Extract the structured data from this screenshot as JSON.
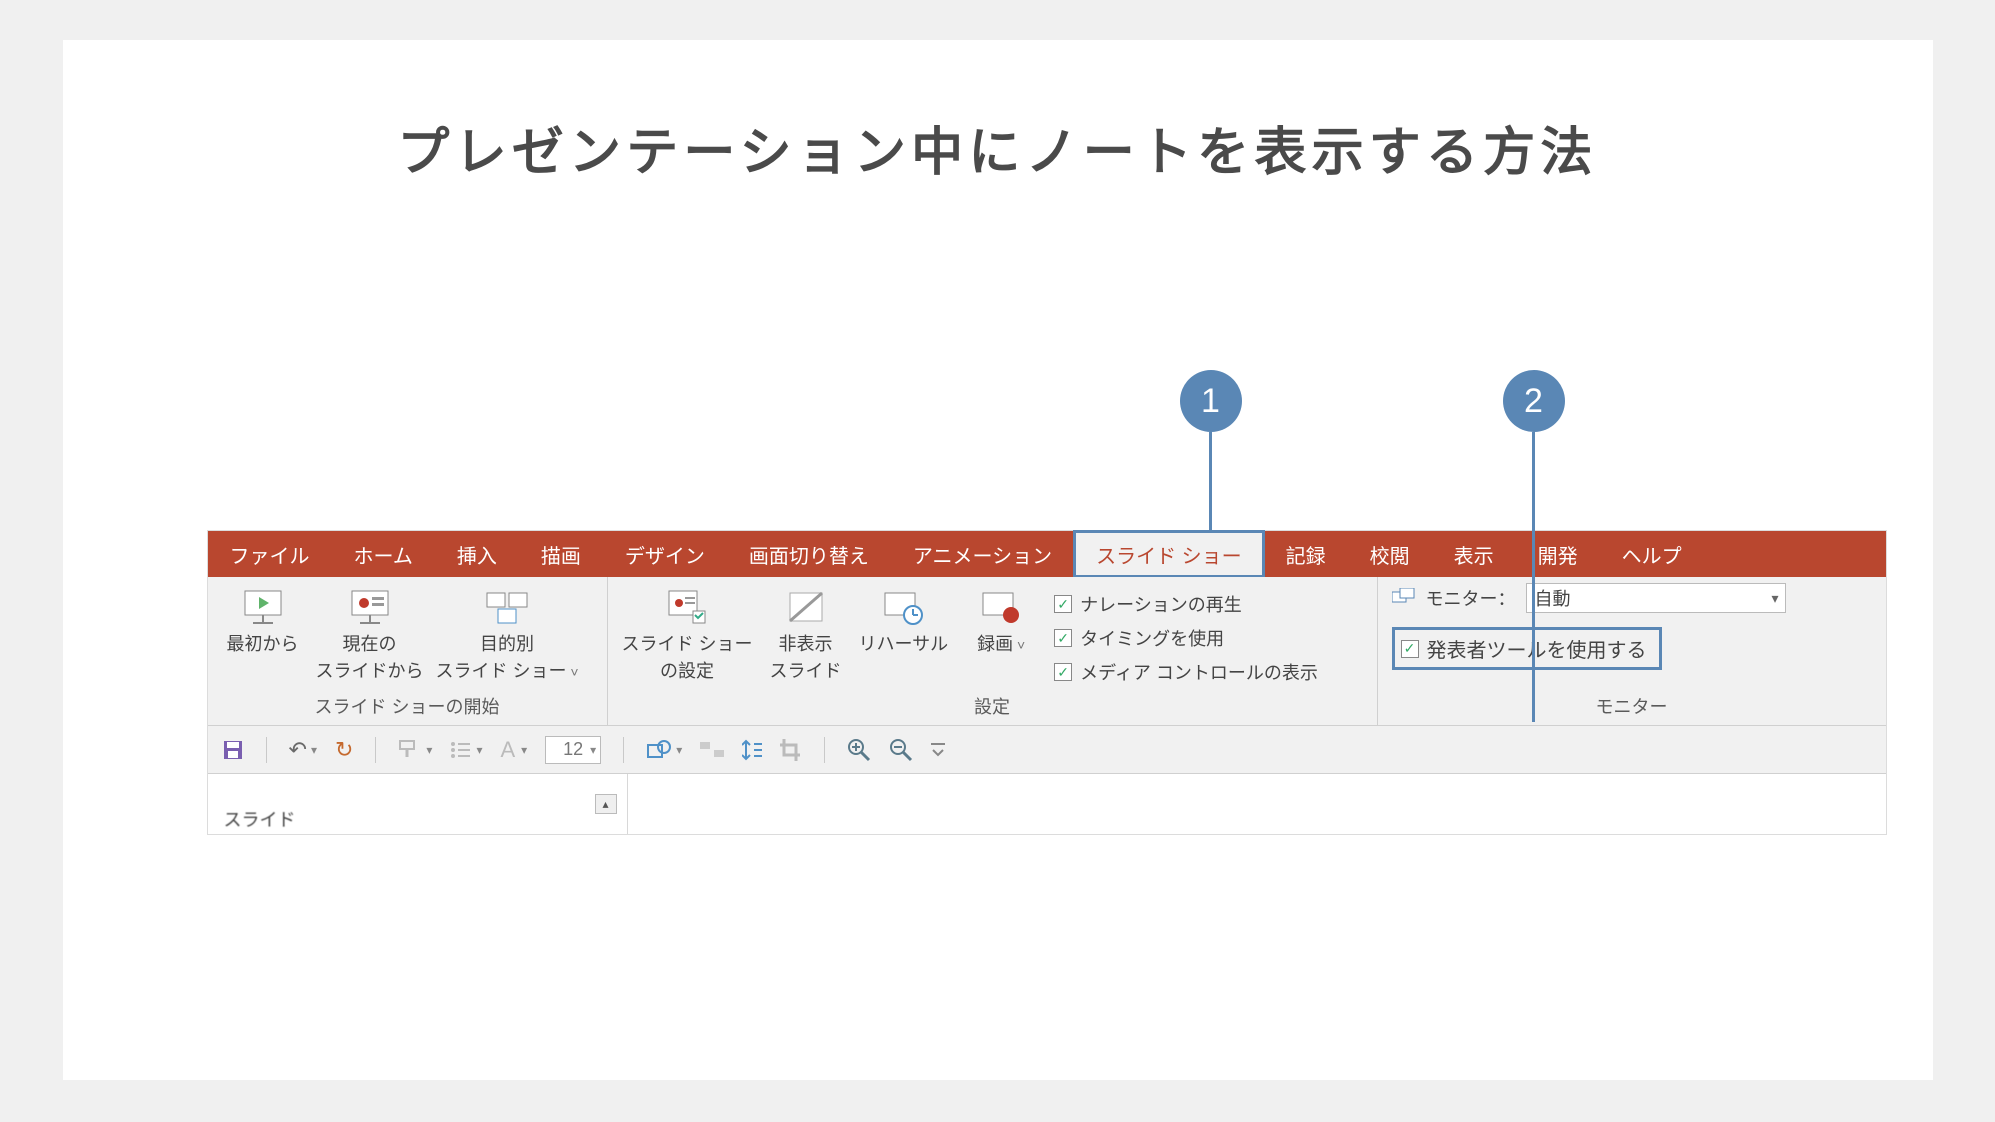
{
  "title": "プレゼンテーション中にノートを表示する方法",
  "callouts": {
    "one": "1",
    "two": "2"
  },
  "tabs": {
    "file": "ファイル",
    "home": "ホーム",
    "insert": "挿入",
    "draw": "描画",
    "design": "デザイン",
    "transitions": "画面切り替え",
    "animations": "アニメーション",
    "slideshow": "スライド ショー",
    "record": "記録",
    "review": "校閲",
    "view": "表示",
    "developer": "開発",
    "help": "ヘルプ"
  },
  "ribbon": {
    "start": {
      "label": "スライド ショーの開始",
      "fromStart": "最初から",
      "fromCurrent1": "現在の",
      "fromCurrent2": "スライドから",
      "custom1": "目的別",
      "custom2": "スライド ショー"
    },
    "setup": {
      "label": "設定",
      "settings1": "スライド ショー",
      "settings2": "の設定",
      "hide1": "非表示",
      "hide2": "スライド",
      "rehearse": "リハーサル",
      "record": "録画",
      "checks": {
        "narration": "ナレーションの再生",
        "timings": "タイミングを使用",
        "media": "メディア コントロールの表示"
      }
    },
    "monitor": {
      "label": "モニター",
      "labelColon": "モニター：",
      "auto": "自動",
      "presenter": "発表者ツールを使用する"
    }
  },
  "qat": {
    "fontSize": "12"
  },
  "panelLabel": "スライド"
}
